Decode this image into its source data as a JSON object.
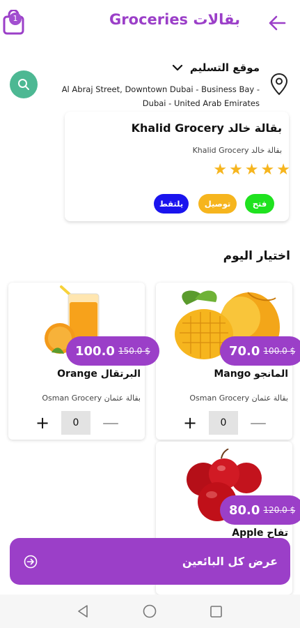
{
  "header": {
    "cart_count": "1",
    "title": "Groceries بقالات"
  },
  "location": {
    "title": "موقع التسليم",
    "address": "Al Abraj Street, Downtown Dubai - Business Bay - Dubai - United Arab Emirates"
  },
  "store": {
    "name": "Khalid Grocery بقالة خالد",
    "subtitle": "Khalid Grocery بقالة خالد",
    "rating": 5,
    "tags": {
      "open": "فتح",
      "delivery": "توصيل",
      "pickup": "يلتقط"
    }
  },
  "section": {
    "title": "اختيار اليوم"
  },
  "products": [
    {
      "name": "Mango المانجو",
      "store": "Osman Grocery بقالة عثمان",
      "price": "70.0",
      "old_price": "100.0 $",
      "qty": "0"
    },
    {
      "name": "Orange البرتقال",
      "store": "Osman Grocery بقالة عثمان",
      "price": "100.0",
      "old_price": "150.0 $",
      "qty": "0"
    },
    {
      "name": "Apple تفاح",
      "price": "80.0",
      "old_price": "120.0 $"
    }
  ],
  "actions": {
    "view_all_vendors": "عرض كل البائعين"
  },
  "colors": {
    "primary": "#9b3fc8",
    "search": "#4db893",
    "star": "#f6b51e",
    "open": "#1fe21f",
    "delivery": "#f6b51e",
    "pickup": "#1a14ee"
  }
}
